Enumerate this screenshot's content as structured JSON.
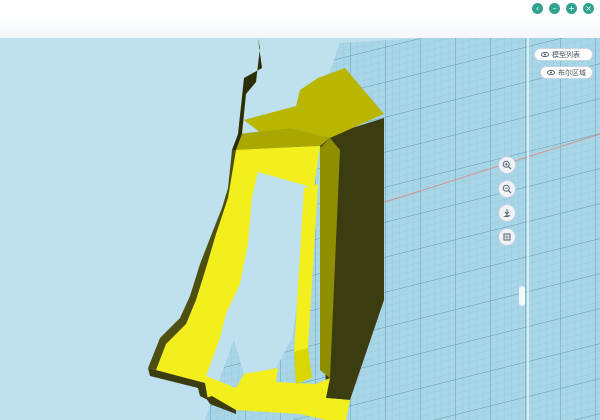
{
  "window": {
    "controls": [
      {
        "name": "back",
        "glyph": "‹"
      },
      {
        "name": "minimize",
        "glyph": "–"
      },
      {
        "name": "maximize",
        "glyph": "+"
      },
      {
        "name": "close",
        "glyph": "×"
      }
    ]
  },
  "panel": {
    "model_list": "模型列表",
    "layers": "布尔区域"
  },
  "toolbar": {
    "tools": [
      {
        "name": "zoom-in",
        "icon": "zoom-in-icon"
      },
      {
        "name": "zoom-out",
        "icon": "zoom-out-icon"
      },
      {
        "name": "place-on-ground",
        "icon": "download-arrow-icon"
      },
      {
        "name": "view-cube",
        "icon": "cube-icon"
      }
    ]
  },
  "colors": {
    "model_bright": "#f2ef1c",
    "model_top": "#b8b600",
    "model_dark": "#3b3d10",
    "grid_plane": "#a8d6e6",
    "grid_line": "#6aa9c3",
    "axis_red": "#d98a86",
    "sky": "#bfe0ee",
    "accent": "#2fa38f"
  }
}
